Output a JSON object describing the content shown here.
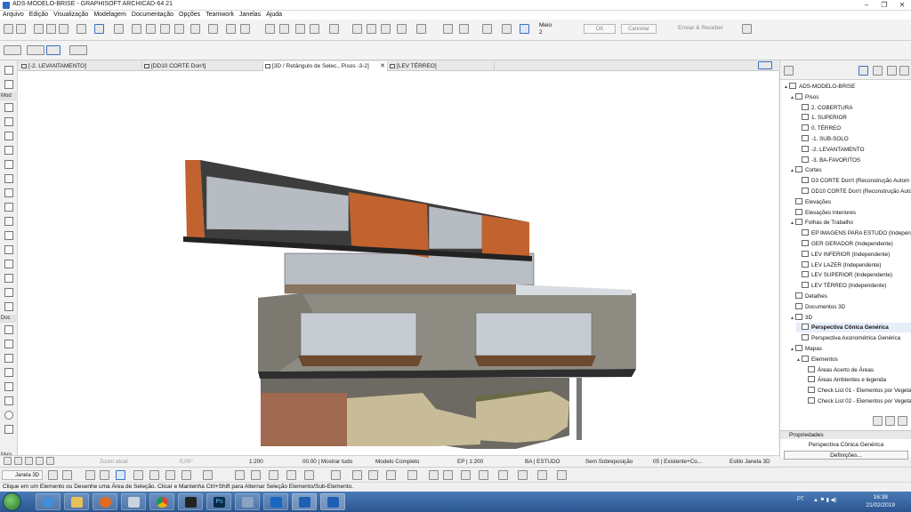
{
  "window": {
    "title": "ADS-MODELO-BRISE - GRAPHISOFT ARCHICAD-64 21"
  },
  "menu": [
    "Arquivo",
    "Edição",
    "Visualização",
    "Modelagem",
    "Documentação",
    "Opções",
    "Teamwork",
    "Janelas",
    "Ajuda"
  ],
  "toolbar": {
    "meio_label": "Meio",
    "meio_value": "2",
    "ok_label": "OK",
    "cancel_label": "Cancelar",
    "send_receive_label": "Enviar & Receber"
  },
  "toolbox": {
    "section_model": "Mod",
    "section_doc": "Doc",
    "section_more": "Mais"
  },
  "tabs": [
    {
      "label": "[-2. LEVANTAMENTO]"
    },
    {
      "label": "[DD10 CORTE Don't]"
    },
    {
      "label": "[3D / Retângulo de Selec., Pisos -3-2]"
    },
    {
      "label": "[LEV TÉRREO]"
    }
  ],
  "navigator": {
    "rows": [
      {
        "label": "ADS-MODELO-BRISE",
        "level": 0,
        "exp": "▲"
      },
      {
        "label": "Pisos",
        "level": 1,
        "exp": "▲"
      },
      {
        "label": "2. COBERTURA",
        "level": 2,
        "exp": ""
      },
      {
        "label": "1. SUPERIOR",
        "level": 2,
        "exp": ""
      },
      {
        "label": "0. TÉRREO",
        "level": 2,
        "exp": ""
      },
      {
        "label": "-1. SUB-SOLO",
        "level": 2,
        "exp": ""
      },
      {
        "label": "-2. LEVANTAMENTO",
        "level": 2,
        "exp": ""
      },
      {
        "label": "-3. BA-FAVORITOS",
        "level": 2,
        "exp": ""
      },
      {
        "label": "Cortes",
        "level": 1,
        "exp": "▲"
      },
      {
        "label": "D3 CORTE Don't (Reconstrução Autom",
        "level": 2,
        "exp": ""
      },
      {
        "label": "DD10 CORTE Don't (Reconstrução Auto",
        "level": 2,
        "exp": ""
      },
      {
        "label": "Elevações",
        "level": 1,
        "exp": ""
      },
      {
        "label": "Elevações Interiores",
        "level": 1,
        "exp": ""
      },
      {
        "label": "Folhas de Trabalho",
        "level": 1,
        "exp": "▲"
      },
      {
        "label": "EP IMAGENS PARA ESTUDO (Independe",
        "level": 2,
        "exp": ""
      },
      {
        "label": "GER GERADOR (Independente)",
        "level": 2,
        "exp": ""
      },
      {
        "label": "LEV INFERIOR (Independente)",
        "level": 2,
        "exp": ""
      },
      {
        "label": "LEV LAZER (Independente)",
        "level": 2,
        "exp": ""
      },
      {
        "label": "LEV SUPERIOR (Independente)",
        "level": 2,
        "exp": ""
      },
      {
        "label": "LEV TÉRREO (Independente)",
        "level": 2,
        "exp": ""
      },
      {
        "label": "Detalhes",
        "level": 1,
        "exp": ""
      },
      {
        "label": "Documentos 3D",
        "level": 1,
        "exp": ""
      },
      {
        "label": "3D",
        "level": 1,
        "exp": "▲"
      },
      {
        "label": "Perspectiva Cônica Genérica",
        "level": 2,
        "exp": "",
        "selected": true
      },
      {
        "label": "Perspectiva Axonométrica Genérica",
        "level": 2,
        "exp": ""
      },
      {
        "label": "Mapas",
        "level": 1,
        "exp": "▲"
      },
      {
        "label": "Elementos",
        "level": 2,
        "exp": "▲"
      },
      {
        "label": "Áreas Acerto de Áreas",
        "level": 3,
        "exp": ""
      },
      {
        "label": "Áreas Ambientes e legenda",
        "level": 3,
        "exp": ""
      },
      {
        "label": "Check List 01 - Elementos por Vegeta",
        "level": 3,
        "exp": ""
      },
      {
        "label": "Check List 02 - Elementos por Vegeta",
        "level": 3,
        "exp": ""
      }
    ]
  },
  "properties": {
    "header": "Propriedades",
    "value": "Perspectiva Cônica Genérica",
    "button": "Definições..."
  },
  "quickbar": {
    "zoom": "Zoom atual",
    "angle": "0,00°",
    "scale": "1:200",
    "layers": "00.00 | Mostrar tudo",
    "model": "Modelo Completo",
    "pen": "EP | 1:200",
    "study": "BA | ESTUDO",
    "override": "Sem Sobreposição",
    "renovation": "05 | Existente+Co...",
    "style": "Estilo Janela 3D"
  },
  "infobar": {
    "window_label": "Janela 3D"
  },
  "status": {
    "hint": "Clique em um Elemento ou Desenhe uma Área de Seleção. Clicar e Mantenha Ctrl+Shift para Alternar Seleção Elemento/Sub-Elemento."
  },
  "taskbar": {
    "lang": "PT",
    "time": "16:38",
    "date": "21/02/2019"
  },
  "colors": {
    "facade_copper": "#c2622e",
    "stone": "#8e8b82",
    "brick": "#a06a50",
    "rubble": "#c8bc98",
    "taskbar_blue": "#2a5590"
  }
}
